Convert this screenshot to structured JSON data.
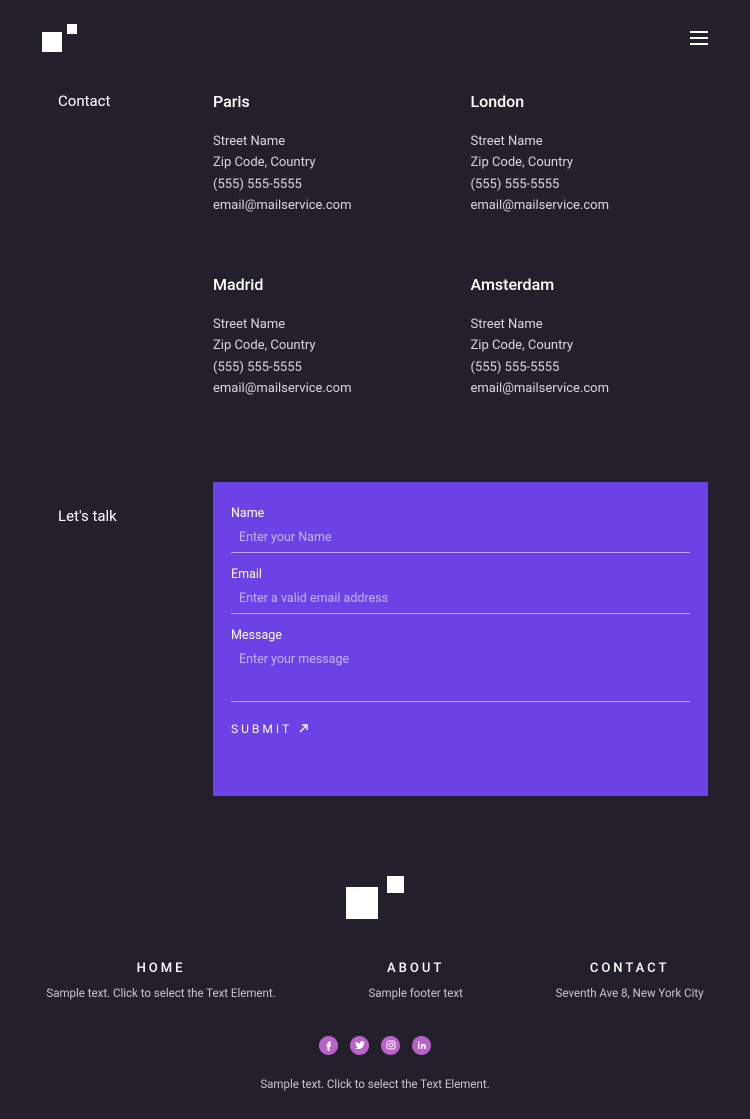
{
  "contact": {
    "heading": "Contact",
    "talkHeading": "Let's talk",
    "locations": [
      {
        "city": "Paris",
        "street": "Street Name",
        "zip": "Zip Code, Country",
        "phone": "(555) 555-5555",
        "email": "email@mailservice.com"
      },
      {
        "city": "London",
        "street": "Street Name",
        "zip": "Zip Code, Country",
        "phone": "(555) 555-5555",
        "email": "email@mailservice.com"
      },
      {
        "city": "Madrid",
        "street": "Street Name",
        "zip": "Zip Code, Country",
        "phone": "(555) 555-5555",
        "email": "email@mailservice.com"
      },
      {
        "city": "Amsterdam",
        "street": "Street Name",
        "zip": "Zip Code, Country",
        "phone": "(555) 555-5555",
        "email": "email@mailservice.com"
      }
    ]
  },
  "form": {
    "nameLabel": "Name",
    "namePlaceholder": "Enter your Name",
    "emailLabel": "Email",
    "emailPlaceholder": "Enter a valid email address",
    "messageLabel": "Message",
    "messagePlaceholder": "Enter your message",
    "submit": "SUBMIT"
  },
  "footer": {
    "cols": [
      {
        "title": "HOME",
        "text": "Sample text. Click to select the Text Element."
      },
      {
        "title": "ABOUT",
        "text": "Sample footer text"
      },
      {
        "title": "CONTACT",
        "text": "Seventh Ave 8, New York City"
      }
    ],
    "copy": "Sample text. Click to select the Text Element."
  }
}
